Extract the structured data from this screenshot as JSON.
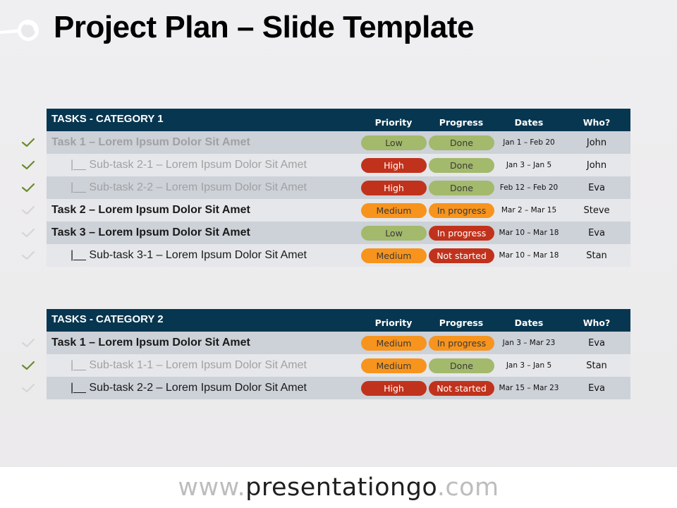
{
  "slide": {
    "title": "Project Plan – Slide Template",
    "logo_icon": "magnifier-key-icon"
  },
  "colors": {
    "header_bg": "#073650",
    "row_dark": "#cdd1d8",
    "row_light": "#e6e7eb",
    "green": "#a3b96b",
    "red": "#c1321c",
    "orange": "#f7941d",
    "check_done": "#6b8a2e",
    "check_pending": "#d6d6d6"
  },
  "tables": [
    {
      "category": "TASKS - CATEGORY 1",
      "columns": {
        "priority": "Priority",
        "progress": "Progress",
        "dates": "Dates",
        "who": "Who?"
      },
      "rows": [
        {
          "task": "Task 1 – Lorem Ipsum Dolor Sit Amet",
          "level": "task",
          "done": true,
          "priority": "Low",
          "priority_color": "green",
          "progress": "Done",
          "progress_color": "green",
          "dates": "Jan 1 – Feb 20",
          "who": "John"
        },
        {
          "task": "|__ Sub-task 2-1 – Lorem Ipsum Dolor Sit Amet",
          "level": "sub",
          "done": true,
          "priority": "High",
          "priority_color": "red",
          "progress": "Done",
          "progress_color": "green",
          "dates": "Jan 3 – Jan 5",
          "who": "John"
        },
        {
          "task": "|__ Sub-task 2-2 – Lorem Ipsum Dolor Sit Amet",
          "level": "sub",
          "done": true,
          "priority": "High",
          "priority_color": "red",
          "progress": "Done",
          "progress_color": "green",
          "dates": "Feb 12 – Feb 20",
          "who": "Eva"
        },
        {
          "task": "Task 2 – Lorem Ipsum Dolor Sit Amet",
          "level": "task",
          "done": false,
          "priority": "Medium",
          "priority_color": "orange",
          "progress": "In progress",
          "progress_color": "orange",
          "dates": "Mar 2 – Mar 15",
          "who": "Steve"
        },
        {
          "task": "Task 3 – Lorem Ipsum Dolor Sit Amet",
          "level": "task",
          "done": false,
          "priority": "Low",
          "priority_color": "green",
          "progress": "In progress",
          "progress_color": "red",
          "dates": "Mar 10 – Mar 18",
          "who": "Eva"
        },
        {
          "task": "|__ Sub-task 3-1 – Lorem Ipsum Dolor Sit Amet",
          "level": "sub",
          "done": false,
          "priority": "Medium",
          "priority_color": "orange",
          "progress": "Not started",
          "progress_color": "red",
          "dates": "Mar 10 – Mar 18",
          "who": "Stan"
        }
      ]
    },
    {
      "category": "TASKS - CATEGORY 2",
      "columns": {
        "priority": "Priority",
        "progress": "Progress",
        "dates": "Dates",
        "who": "Who?"
      },
      "rows": [
        {
          "task": "Task 1 – Lorem Ipsum Dolor Sit Amet",
          "level": "task",
          "done": false,
          "priority": "Medium",
          "priority_color": "orange",
          "progress": "In progress",
          "progress_color": "orange",
          "dates": "Jan 3 – Mar 23",
          "who": "Eva"
        },
        {
          "task": "|__ Sub-task 1-1 – Lorem Ipsum Dolor Sit Amet",
          "level": "sub",
          "done": true,
          "priority": "Medium",
          "priority_color": "orange",
          "progress": "Done",
          "progress_color": "green",
          "dates": "Jan 3 – Jan 5",
          "who": "Stan"
        },
        {
          "task": "|__ Sub-task 2-2 – Lorem Ipsum Dolor Sit Amet",
          "level": "sub",
          "done": false,
          "priority": "High",
          "priority_color": "red",
          "progress": "Not started",
          "progress_color": "red",
          "dates": "Mar 15 – Mar 23",
          "who": "Eva"
        }
      ]
    }
  ],
  "footer": {
    "url_prefix": "www.",
    "url_brand": "presentationgo",
    "url_suffix": ".com"
  }
}
